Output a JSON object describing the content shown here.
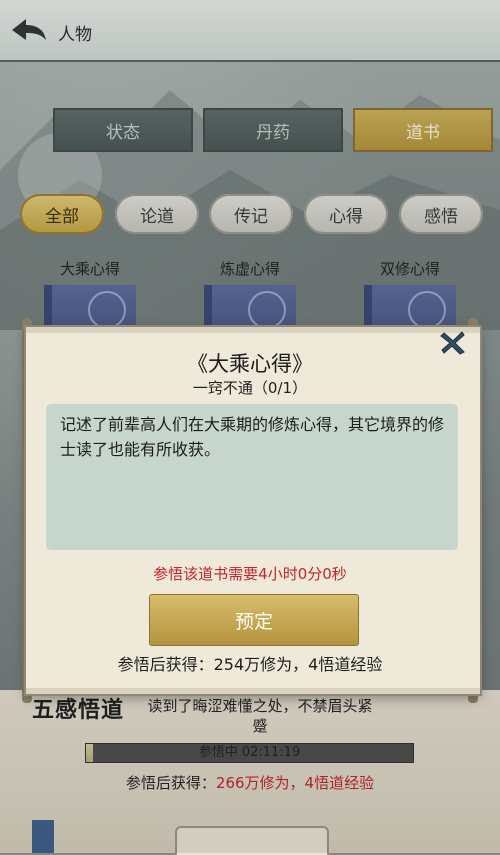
{
  "header": {
    "title": "人物"
  },
  "main_tabs": [
    {
      "label": "状态"
    },
    {
      "label": "丹药"
    },
    {
      "label": "道书"
    }
  ],
  "filters": [
    {
      "label": "全部"
    },
    {
      "label": "论道"
    },
    {
      "label": "传记"
    },
    {
      "label": "心得"
    },
    {
      "label": "感悟"
    }
  ],
  "books": [
    {
      "title": "大乘心得"
    },
    {
      "title": "炼虚心得"
    },
    {
      "title": "双修心得"
    }
  ],
  "background_panel": {
    "text": "读到了晦涩难懂之处，不禁眉头紧蹙",
    "progress_text": "参悟中 02:11:19",
    "progress_fraction": 0.02,
    "reward_label": "参悟后获得：",
    "reward_value": "266万修为，4悟道经验"
  },
  "modal": {
    "title": "《大乘心得》",
    "subtitle": "一窍不通（0/1）",
    "description": "记述了前辈高人们在大乘期的修炼心得，其它境界的修士读了也能有所收获。",
    "requirement": "参悟该道书需要4小时0分0秒",
    "reserve_label": "预定",
    "gain_text": "参悟后获得：254万修为，4悟道经验"
  },
  "colors": {
    "accent_gold": "#c6a544",
    "requirement_red": "#c52428"
  }
}
